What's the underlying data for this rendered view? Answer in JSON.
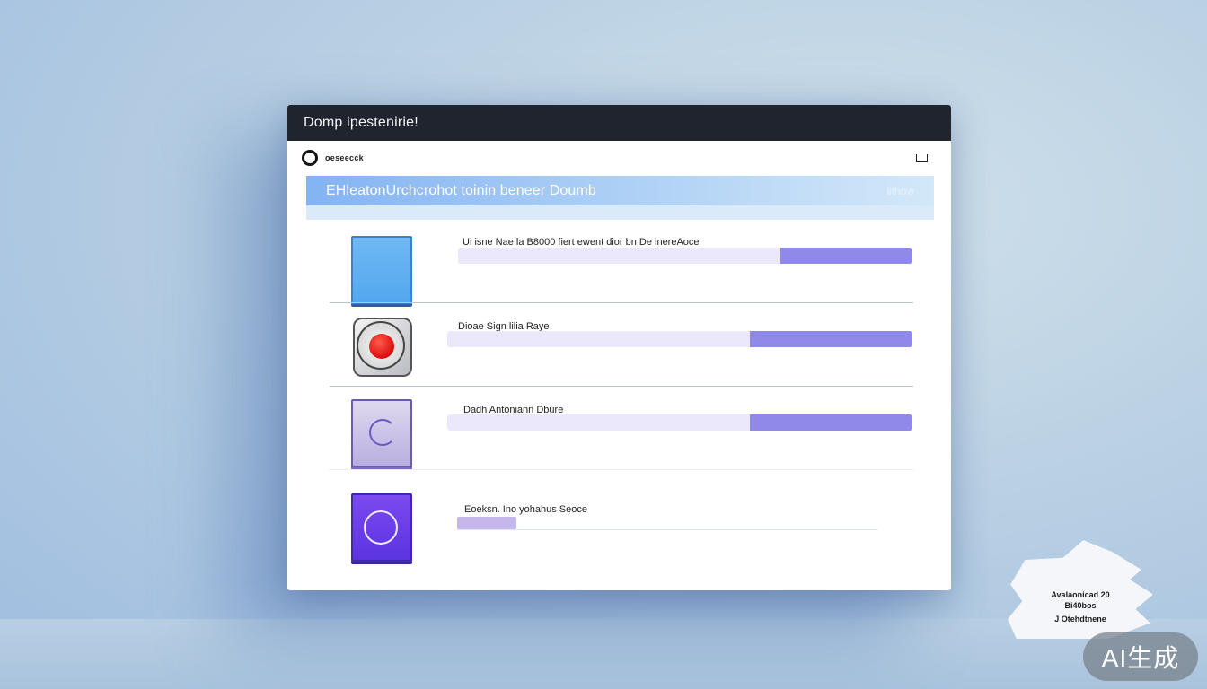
{
  "window": {
    "title": "Domp  ipestenirie!"
  },
  "toolbar": {
    "label": "oeseecck"
  },
  "banner": {
    "title": "EHleatonUrchcrohot toinin beneer Doumb",
    "link": "lithow"
  },
  "items": [
    {
      "label": "Ui isne Nae la B8000 fiert ewent dior bn  De inereAoce",
      "progress": 0.29
    },
    {
      "label": "Dioae Sign lilia Raye",
      "progress": 0.35
    },
    {
      "label": "Dadh Antoniann Dbure",
      "progress": 0.35
    },
    {
      "label": "Eoeksn. Ino yohahus Seoce",
      "progress": 0.14
    }
  ],
  "badge": {
    "line1": "Avalaonicad 20",
    "line2": "Bi40bos",
    "line3": "J Otehdtnene"
  },
  "watermark": "AI生成"
}
